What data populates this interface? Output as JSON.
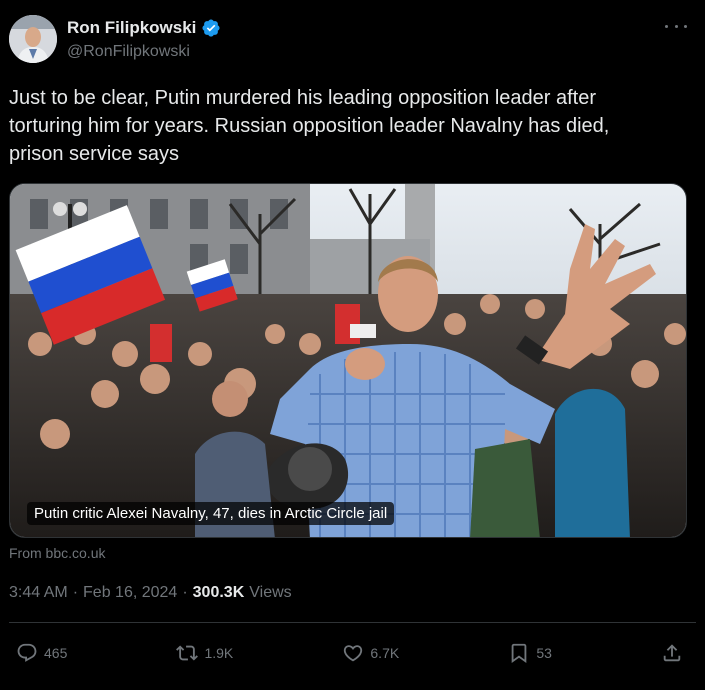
{
  "author": {
    "name": "Ron Filipkowski",
    "handle": "@RonFilipkowski",
    "verified": true,
    "verified_color": "#1d9bf0"
  },
  "tweet": {
    "text": "Just to be clear, Putin murdered his leading opposition leader after\ntorturing him for years. Russian opposition leader Navalny has died,\nprison service says"
  },
  "card": {
    "image_icon": "rally-photo",
    "caption": "Putin critic Alexei Navalny, 47, dies in Arctic Circle jail",
    "source": "From bbc.co.uk"
  },
  "meta": {
    "time": "3:44 AM",
    "separator1": "·",
    "date": "Feb 16, 2024",
    "separator2": "·",
    "views_count": "300.3K",
    "views_label": "Views"
  },
  "actions": {
    "replies": "465",
    "reposts": "1.9K",
    "likes": "6.7K",
    "bookmarks": "53"
  },
  "colors": {
    "background": "#000000",
    "text": "#e7e9ea",
    "muted": "#71767b",
    "border": "#2f3336"
  }
}
